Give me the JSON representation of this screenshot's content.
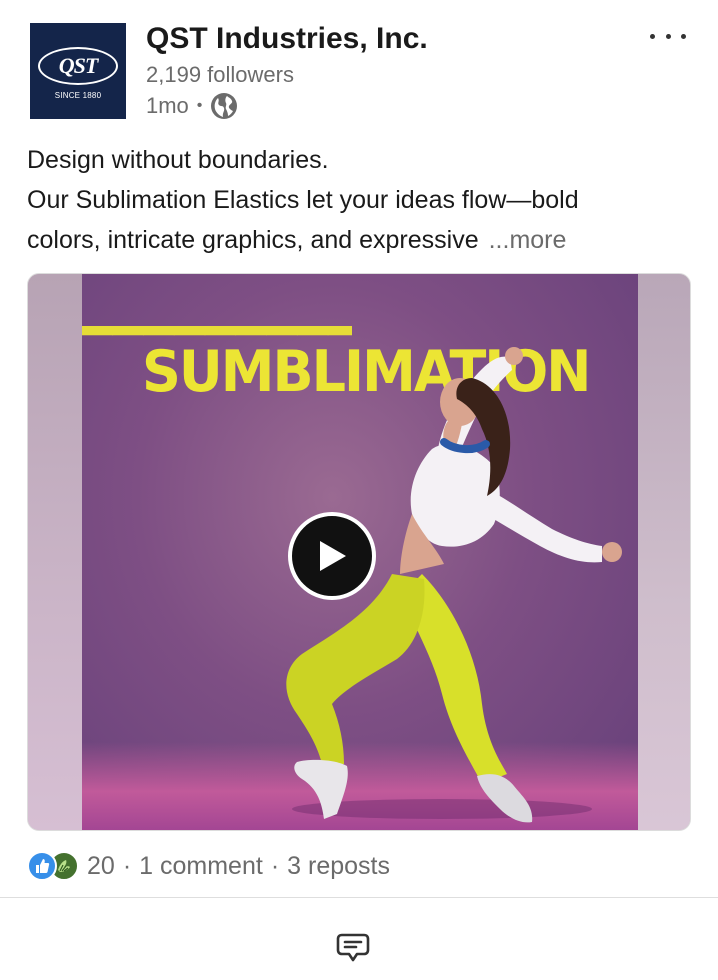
{
  "header": {
    "logo_text": "QST",
    "logo_tagline": "SINCE 1880",
    "company_name": "QST Industries, Inc.",
    "followers": "2,199 followers",
    "time_ago": "1mo",
    "dot": "•",
    "visibility_icon": "globe-icon",
    "menu_icon": "ellipsis-icon"
  },
  "post": {
    "lines": [
      "Design without boundaries.",
      "Our Sublimation Elastics let your ideas flow—bold",
      "colors, intricate graphics, and expressive"
    ],
    "more_label": "...more"
  },
  "media": {
    "headline": "SUMBLIMATION",
    "play_icon": "play-icon",
    "colors": {
      "background": "#7e4f84",
      "headline": "#ece534",
      "pants": "#d8e02a",
      "shirt": "#f4f1f5"
    }
  },
  "social": {
    "reaction_icons": [
      "like-icon",
      "celebrate-icon"
    ],
    "reactions_count": "20",
    "separator": "·",
    "comments": "1 comment",
    "reposts": "3 reposts"
  },
  "actions": {
    "comment_icon": "comment-icon"
  }
}
